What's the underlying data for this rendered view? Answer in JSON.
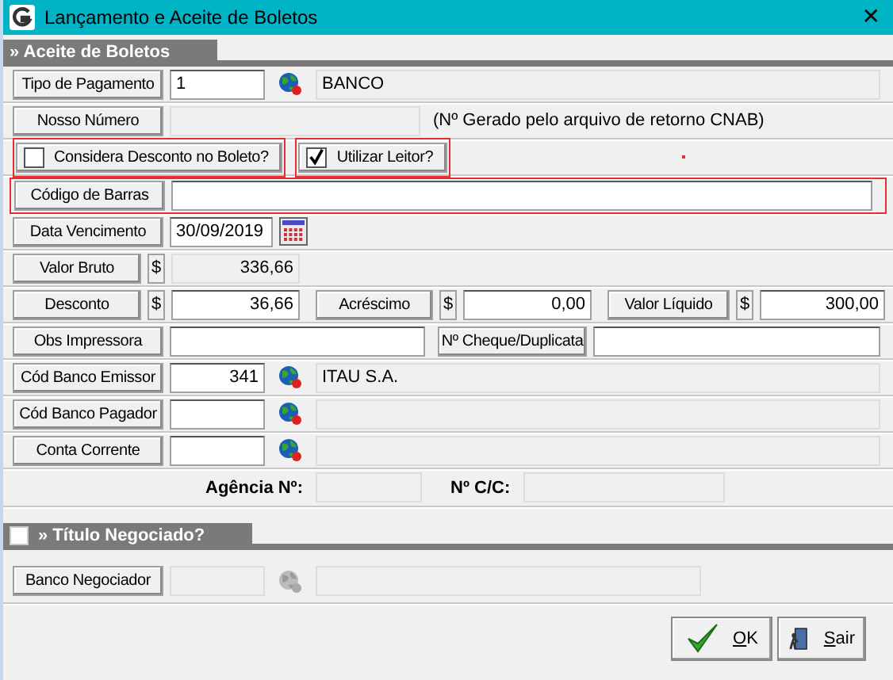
{
  "window": {
    "title": "Lançamento e Aceite de Boletos",
    "close": "✕"
  },
  "section": {
    "title": "» Aceite de Boletos"
  },
  "tipo_pagamento": {
    "label": "Tipo de Pagamento",
    "value": "1",
    "description": "BANCO"
  },
  "nosso_numero": {
    "label": "Nosso Número",
    "note": "(Nº Gerado pelo arquivo de retorno CNAB)"
  },
  "options": [
    {
      "label": "Considera Desconto no Boleto?",
      "checked": false,
      "highlighted": true
    },
    {
      "label": "Utilizar Leitor?",
      "checked": true,
      "highlighted": true
    }
  ],
  "codigo_barras": {
    "label": "Código de Barras",
    "highlighted": true
  },
  "data_vencimento": {
    "label": "Data Vencimento",
    "value": "30/09/2019"
  },
  "valor_bruto": {
    "label": "Valor Bruto",
    "currency": "$",
    "value": "336,66"
  },
  "amounts": [
    {
      "label": "Desconto",
      "currency": "$",
      "value": "36,66"
    },
    {
      "label": "Acréscimo",
      "currency": "$",
      "value": "0,00"
    },
    {
      "label": "Valor Líquido",
      "currency": "$",
      "value": "300,00"
    }
  ],
  "obs_impressora": {
    "label": "Obs Impressora"
  },
  "cheque": {
    "label": "Nº Cheque/Duplicata"
  },
  "banks": [
    {
      "label": "Cód Banco Emissor",
      "value": "341",
      "description": "ITAU S.A."
    },
    {
      "label": "Cód Banco Pagador"
    },
    {
      "label": "Conta Corrente"
    }
  ],
  "agencia": {
    "label": "Agência Nº:"
  },
  "conta": {
    "label": "Nº C/C:"
  },
  "titulo_negociado": {
    "title": "» Título Negociado?",
    "checked": false
  },
  "banco_negociador": {
    "label": "Banco Negociador",
    "disabled": true
  },
  "buttons": [
    {
      "label": "OK",
      "kind": "ok"
    },
    {
      "label": "Sair",
      "kind": "exit"
    }
  ]
}
